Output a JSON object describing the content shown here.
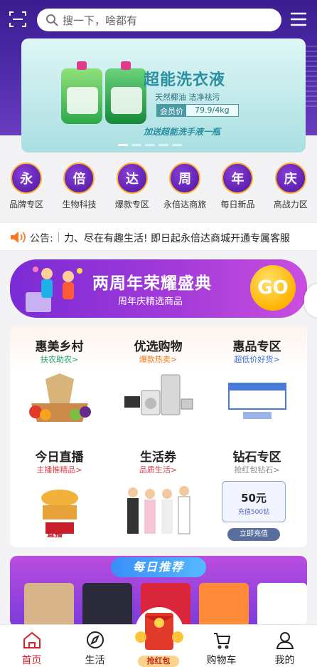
{
  "search": {
    "placeholder": "搜一下，啥都有"
  },
  "banner": {
    "title": "超能洗衣液",
    "subtitle": "天然椰油 洁净祛污",
    "price_label": "会员价",
    "price_value": "79.9/4kg",
    "slogan": "加送超能洗手液一瓶"
  },
  "categories": [
    {
      "char": "永",
      "label": "品牌专区"
    },
    {
      "char": "倍",
      "label": "生物科技"
    },
    {
      "char": "达",
      "label": "爆款专区"
    },
    {
      "char": "周",
      "label": "永倍达商旅"
    },
    {
      "char": "年",
      "label": "每日新品"
    },
    {
      "char": "庆",
      "label": "高战力区"
    }
  ],
  "notice": {
    "label": "公告:",
    "text": "力、尽在有趣生活! 即日起永倍达商城开通专属客服"
  },
  "promo": {
    "title": "两周年荣耀盛典",
    "subtitle": "周年庆精选商品",
    "go": "GO"
  },
  "sections": [
    {
      "title": "惠美乡村",
      "subtitle": "扶农助农>",
      "color": "#1aa86b"
    },
    {
      "title": "优选购物",
      "subtitle": "爆款热卖>",
      "color": "#f07a1c"
    },
    {
      "title": "惠品专区",
      "subtitle": "超低价好货>",
      "color": "#3a6fd8"
    },
    {
      "title": "今日直播",
      "subtitle": "主播推精品>",
      "color": "#e0404a"
    },
    {
      "title": "生活券",
      "subtitle": "品质生活>",
      "color": "#e0404a"
    },
    {
      "title": "钻石专区",
      "subtitle": "抢红包钻石>",
      "color": "#888888"
    }
  ],
  "live": {
    "badge": "直播"
  },
  "recharge": {
    "value": "50元",
    "desc": "充值500钻",
    "button": "立即充值"
  },
  "daily": {
    "title": "每日推荐"
  },
  "tabs": [
    {
      "label": "首页",
      "icon": "home-icon",
      "active": true
    },
    {
      "label": "生活",
      "icon": "compass-icon",
      "active": false
    },
    {
      "label": "抢红包",
      "icon": "red-packet-icon",
      "active": false
    },
    {
      "label": "购物车",
      "icon": "cart-icon",
      "active": false
    },
    {
      "label": "我的",
      "icon": "user-icon",
      "active": false
    }
  ],
  "colors": {
    "accent": "#d6202b",
    "brand_purple": "#5d22b0"
  }
}
